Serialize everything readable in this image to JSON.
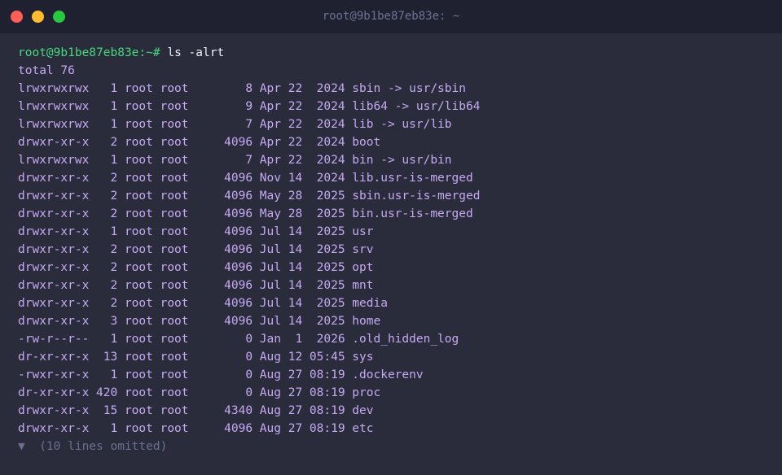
{
  "window": {
    "title": "root@9b1be87eb83e: ~",
    "buttons": {
      "close_color": "#ff5f57",
      "minimize_color": "#febc2e",
      "maximize_color": "#28c840"
    }
  },
  "terminal": {
    "prompt": "root@9b1be87eb83e:~#",
    "command": " ls -alrt",
    "total": "total 76",
    "listing": [
      "lrwxrwxrwx   1 root root        8 Apr 22  2024 sbin -> usr/sbin",
      "lrwxrwxrwx   1 root root        9 Apr 22  2024 lib64 -> usr/lib64",
      "lrwxrwxrwx   1 root root        7 Apr 22  2024 lib -> usr/lib",
      "drwxr-xr-x   2 root root     4096 Apr 22  2024 boot",
      "lrwxrwxrwx   1 root root        7 Apr 22  2024 bin -> usr/bin",
      "drwxr-xr-x   2 root root     4096 Nov 14  2024 lib.usr-is-merged",
      "drwxr-xr-x   2 root root     4096 May 28  2025 sbin.usr-is-merged",
      "drwxr-xr-x   2 root root     4096 May 28  2025 bin.usr-is-merged",
      "drwxr-xr-x   1 root root     4096 Jul 14  2025 usr",
      "drwxr-xr-x   2 root root     4096 Jul 14  2025 srv",
      "drwxr-xr-x   2 root root     4096 Jul 14  2025 opt",
      "drwxr-xr-x   2 root root     4096 Jul 14  2025 mnt",
      "drwxr-xr-x   2 root root     4096 Jul 14  2025 media",
      "drwxr-xr-x   3 root root     4096 Jul 14  2025 home",
      "-rw-r--r--   1 root root        0 Jan  1  2026 .old_hidden_log",
      "dr-xr-xr-x  13 root root        0 Aug 12 05:45 sys",
      "-rwxr-xr-x   1 root root        0 Aug 27 08:19 .dockerenv",
      "dr-xr-xr-x 420 root root        0 Aug 27 08:19 proc",
      "drwxr-xr-x  15 root root     4340 Aug 27 08:19 dev",
      "drwxr-xr-x   1 root root     4096 Aug 27 08:19 etc"
    ],
    "omitted": "▼  (10 lines omitted)"
  },
  "colors": {
    "background": "#2a2c3c",
    "titlebar": "#1f2130",
    "prompt": "#47d97a",
    "output": "#c6a9f2",
    "command": "#eef0f8",
    "muted": "#6a7090"
  }
}
